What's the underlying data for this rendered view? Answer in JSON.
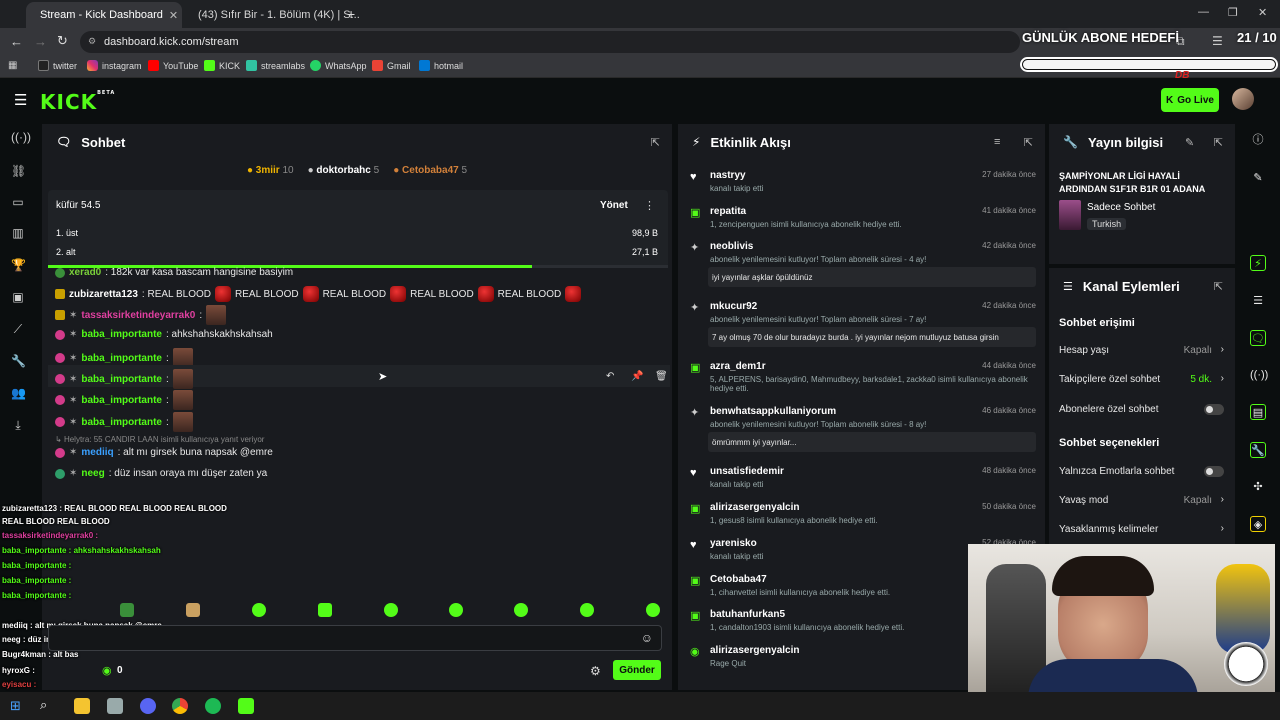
{
  "browser": {
    "tabs": [
      {
        "label": "Stream - Kick Dashboard",
        "active": true
      },
      {
        "label": "(43) Sıfır Bir - 1. Bölüm (4K) | S...",
        "active": false
      }
    ],
    "url": "dashboard.kick.com/stream",
    "bookmarks": [
      "twitter",
      "instagram",
      "YouTube",
      "KICK",
      "streamlabs",
      "WhatsApp",
      "Gmail",
      "hotmail"
    ]
  },
  "overlay": {
    "goal_title": "GÜNLÜK ABONE HEDEFİ",
    "goal_count": "21 / 10",
    "brand_text": "DB"
  },
  "header": {
    "logo": "KICK",
    "logo_beta": "BETA",
    "go_live": "Go Live"
  },
  "chat": {
    "title": "Sohbet",
    "top_gifters": [
      {
        "name": "3miir",
        "count": "10"
      },
      {
        "name": "doktorbahc",
        "count": "5"
      },
      {
        "name": "Cetobaba47",
        "count": "5"
      }
    ],
    "prediction": {
      "title": "küfür 54.5",
      "manage": "Yönet",
      "options": [
        {
          "label": "1. üst",
          "value": "98,9 B"
        },
        {
          "label": "2. alt",
          "value": "27,1 B"
        }
      ],
      "progress_fraction": 0.78
    },
    "messages": [
      {
        "user": "xerad0",
        "text": ": 182k var kasa bascam hangisine basiyim",
        "color": "#7ad03a"
      },
      {
        "user": "zubizaretta123",
        "text": ": REAL BLOOD",
        "color": "#ffffff",
        "repeat": [
          "REAL BLOOD",
          "REAL BLOOD",
          "REAL BLOOD",
          "REAL BLOOD"
        ]
      },
      {
        "user": "tassaksirketindeyarrak0",
        "text": ":",
        "color": "#e040a0"
      },
      {
        "user": "baba_importante",
        "text": ": ahkshahskakhskahsah",
        "color": "#53fc18"
      },
      {
        "user": "baba_importante",
        "text": ":",
        "color": "#53fc18"
      },
      {
        "user": "baba_importante",
        "text": ":",
        "color": "#53fc18"
      },
      {
        "user": "baba_importante",
        "text": ":",
        "color": "#53fc18"
      },
      {
        "user": "baba_importante",
        "text": ":",
        "color": "#53fc18"
      }
    ],
    "reply_hint": "Helytra: 55 CANDIR LAAN isimli kullanıcıya yanıt veriyor",
    "reply_user": "mediiq",
    "reply_text": ": alt mı girsek buna napsak @emre",
    "last_user": "neeg",
    "last_text": ": düz insan oraya mı düşer zaten ya",
    "bottom_status": "0",
    "send_label": "Gönder"
  },
  "stream_overlay_chat": [
    "zubizaretta123 : REAL BLOOD  REAL BLOOD  REAL BLOOD",
    "REAL BLOOD  REAL BLOOD",
    "tassaksirketindeyarrak0 :",
    "baba_importante : ahkshahskakhskahsah",
    "baba_importante :",
    "baba_importante :",
    "baba_importante :",
    "mediiq : alt mı girsek buna napsak @emre",
    "neeg : düz insan oraya mı düşer zaten ya",
    "Bugr4kman : alt bas",
    "hyroxG :",
    "eyisacu :",
    "alpber :"
  ],
  "events": {
    "title": "Etkinlik Akışı",
    "items": [
      {
        "name": "nastryy",
        "sub": "kanalı takip etti",
        "time": "27 dakika önce",
        "icon": "heart"
      },
      {
        "name": "repatita",
        "sub": "1, zencipenguen isimli kullanıcıya abonelik hediye etti.",
        "time": "41 dakika önce",
        "icon": "gift"
      },
      {
        "name": "neoblivis",
        "sub": "abonelik yenilemesini kutluyor! Toplam abonelik süresi - 4 ay!",
        "time": "42 dakika önce",
        "icon": "star",
        "quote": "iyi yayınlar aşklar öpüldünüz"
      },
      {
        "name": "mkucur92",
        "sub": "abonelik yenilemesini kutluyor! Toplam abonelik süresi - 7 ay!",
        "time": "42 dakika önce",
        "icon": "star",
        "quote": "7 ay olmuş 70 de olur buradayız burda . iyi yayınlar nejom mutluyuz batusa girsin"
      },
      {
        "name": "azra_dem1r",
        "sub": "5, ALPERENS, barisaydin0, Mahmudbeyy, barksdale1, zackka0 isimli kullanıcıya abonelik hediye etti.",
        "time": "44 dakika önce",
        "icon": "gift"
      },
      {
        "name": "benwhatsappkullaniyorum",
        "sub": "abonelik yenilemesini kutluyor! Toplam abonelik süresi - 8 ay!",
        "time": "46 dakika önce",
        "icon": "star",
        "quote": "ömrümmm iyi yayınlar..."
      },
      {
        "name": "unsatisfiedemir",
        "sub": "kanalı takip etti",
        "time": "48 dakika önce",
        "icon": "heart"
      },
      {
        "name": "alirizasergenyalcin",
        "sub": "1, gesus8 isimli kullanıcıya abonelik hediye etti.",
        "time": "50 dakika önce",
        "icon": "gift"
      },
      {
        "name": "yarenisko",
        "sub": "kanalı takip etti",
        "time": "52 dakika önce",
        "icon": "heart"
      },
      {
        "name": "Cetobaba47",
        "sub": "1, cihanvettel isimli kullanıcıya abonelik hediye etti.",
        "time": "",
        "icon": "gift"
      },
      {
        "name": "batuhanfurkan5",
        "sub": "1, candalton1903 isimli kullanıcıya abonelik hediye etti.",
        "time": "",
        "icon": "gift"
      },
      {
        "name": "alirizasergenyalcin",
        "sub": "Rage Quit",
        "time": "",
        "icon": "kick"
      }
    ]
  },
  "stream_info": {
    "title": "Yayın bilgisi",
    "stream_title": "ŞAMPİYONLAR LİGİ HAYALİ ARDINDAN S1F1R B1R 01 ADANA",
    "category": "Sadece Sohbet",
    "language": "Turkish"
  },
  "channel_actions": {
    "title": "Kanal Eylemleri",
    "chat_access": "Sohbet erişimi",
    "account_age": {
      "label": "Hesap yaşı",
      "value": "Kapalı"
    },
    "followers_only": {
      "label": "Takipçilere özel sohbet",
      "value": "5 dk."
    },
    "subscribers_only": {
      "label": "Abonelere özel sohbet"
    },
    "chat_options": "Sohbet seçenekleri",
    "emotes_only": {
      "label": "Yalnızca Emotlarla sohbet"
    },
    "slow_mode": {
      "label": "Yavaş mod",
      "value": "Kapalı"
    },
    "banned_words": {
      "label": "Yasaklanmış kelimeler"
    }
  },
  "colors": {
    "accent": "#53fc18",
    "panel": "#191b1f",
    "bg": "#0b0e0f"
  }
}
